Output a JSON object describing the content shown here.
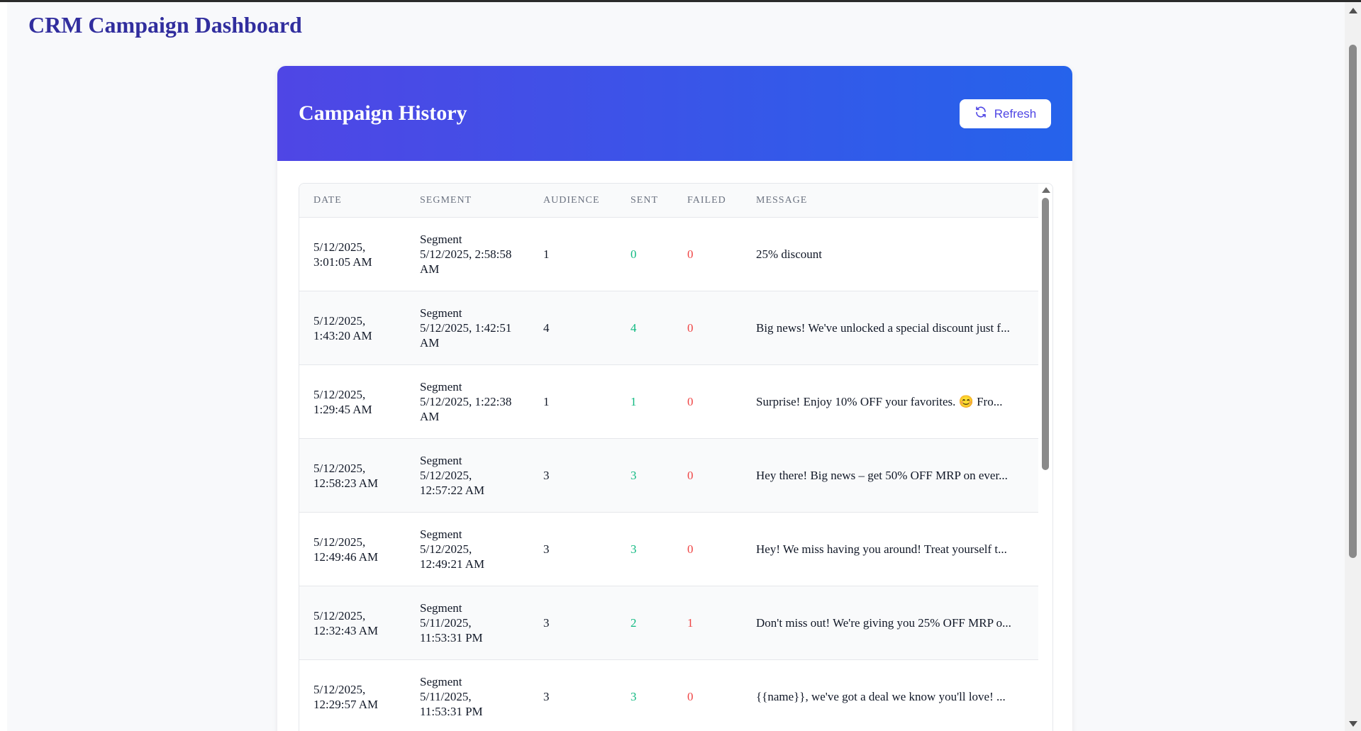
{
  "app": {
    "title": "CRM Campaign Dashboard"
  },
  "card": {
    "title": "Campaign History",
    "refresh_label": "Refresh",
    "refresh_icon": "refresh-icon"
  },
  "colors": {
    "accent": "#4f46e5",
    "header_gradient_start": "#4f46e5",
    "header_gradient_end": "#2563eb",
    "sent": "#10b981",
    "failed": "#ef4444",
    "title": "#312e9e"
  },
  "table": {
    "headers": [
      "DATE",
      "SEGMENT",
      "AUDIENCE",
      "SENT",
      "FAILED",
      "MESSAGE"
    ],
    "rows": [
      {
        "date_line1": "5/12/2025,",
        "date_line2": "3:01:05 AM",
        "segment_line1": "Segment",
        "segment_line2": "5/12/2025, 2:58:58",
        "segment_line3": "AM",
        "audience": "1",
        "sent": "0",
        "failed": "0",
        "message": "25% discount"
      },
      {
        "date_line1": "5/12/2025,",
        "date_line2": "1:43:20 AM",
        "segment_line1": "Segment",
        "segment_line2": "5/12/2025, 1:42:51",
        "segment_line3": "AM",
        "audience": "4",
        "sent": "4",
        "failed": "0",
        "message": "Big news! We've unlocked a special discount just f..."
      },
      {
        "date_line1": "5/12/2025,",
        "date_line2": "1:29:45 AM",
        "segment_line1": "Segment",
        "segment_line2": "5/12/2025, 1:22:38",
        "segment_line3": "AM",
        "audience": "1",
        "sent": "1",
        "failed": "0",
        "message": "Surprise! Enjoy 10% OFF your favorites. 😊 Fro..."
      },
      {
        "date_line1": "5/12/2025,",
        "date_line2": "12:58:23 AM",
        "segment_line1": "Segment",
        "segment_line2": "5/12/2025,",
        "segment_line3": "12:57:22 AM",
        "audience": "3",
        "sent": "3",
        "failed": "0",
        "message": "Hey there! Big news – get 50% OFF MRP on ever..."
      },
      {
        "date_line1": "5/12/2025,",
        "date_line2": "12:49:46 AM",
        "segment_line1": "Segment",
        "segment_line2": "5/12/2025,",
        "segment_line3": "12:49:21 AM",
        "audience": "3",
        "sent": "3",
        "failed": "0",
        "message": "Hey! We miss having you around! Treat yourself t..."
      },
      {
        "date_line1": "5/12/2025,",
        "date_line2": "12:32:43 AM",
        "segment_line1": "Segment",
        "segment_line2": "5/11/2025,",
        "segment_line3": "11:53:31 PM",
        "audience": "3",
        "sent": "2",
        "failed": "1",
        "message": "Don't miss out! We're giving you 25% OFF MRP o..."
      },
      {
        "date_line1": "5/12/2025,",
        "date_line2": "12:29:57 AM",
        "segment_line1": "Segment",
        "segment_line2": "5/11/2025,",
        "segment_line3": "11:53:31 PM",
        "audience": "3",
        "sent": "3",
        "failed": "0",
        "message": "{{name}}, we've got a deal we know you'll love! ..."
      }
    ]
  }
}
